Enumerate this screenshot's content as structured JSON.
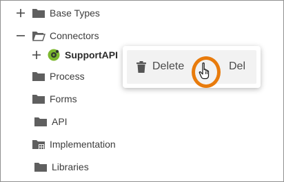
{
  "tree": {
    "base_types": {
      "label": "Base Types",
      "toggle": "plus-icon",
      "icon": "folder-icon"
    },
    "connectors": {
      "label": "Connectors",
      "toggle": "minus-icon",
      "icon": "folder-open-icon"
    },
    "support_api": {
      "label": "SupportAPI",
      "toggle": "plus-icon",
      "icon": "api-connector-icon"
    },
    "process": {
      "label": "Process",
      "icon": "folder-icon"
    },
    "forms": {
      "label": "Forms",
      "icon": "folder-icon"
    },
    "api": {
      "label": "API",
      "icon": "folder-icon"
    },
    "implementation": {
      "label": "Implementation",
      "icon": "folder-grid-icon"
    },
    "libraries": {
      "label": "Libraries",
      "icon": "folder-icon"
    }
  },
  "context_menu": {
    "items": [
      {
        "label": "Delete",
        "shortcut": "Del",
        "icon": "trash-icon"
      }
    ]
  },
  "colors": {
    "folder": "#5f5f5f",
    "highlight_ring": "#e87b0c",
    "menu_hover": "#f2f2f2",
    "connector_green": "#7cb82f"
  }
}
